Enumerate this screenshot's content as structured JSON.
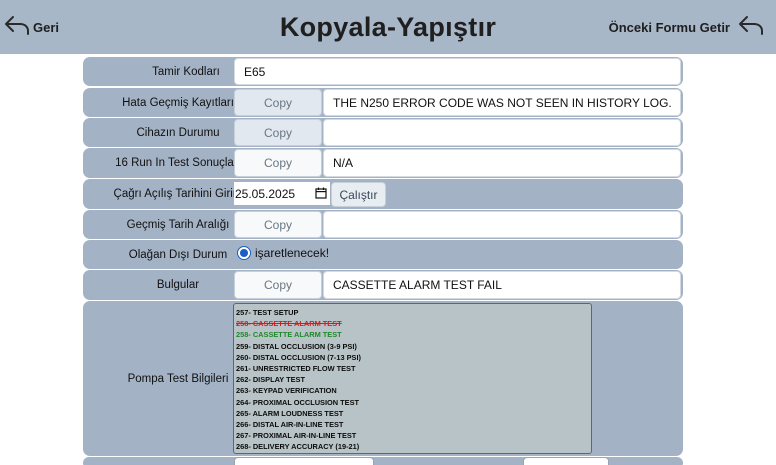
{
  "header": {
    "title": "Kopyala-Yapıştır",
    "back_label": "Geri",
    "previous_form_label": "Önceki Formu Getir"
  },
  "fields": {
    "repair_codes": {
      "label": "Tamir Kodları",
      "value": "E65"
    },
    "error_history": {
      "label": "Hata Geçmiş Kayıtları",
      "copy_label": "Copy",
      "value": "THE N250 ERROR CODE WAS NOT SEEN IN HISTORY LOG."
    },
    "device_status": {
      "label": "Cihazın Durumu",
      "copy_label": "Copy",
      "value": ""
    },
    "run_in_test": {
      "label": "16 Run In Test Sonuçları",
      "copy_label": "Copy",
      "value": "N/A"
    },
    "call_open_date": {
      "label": "Çağrı Açılış Tarihini Girin!",
      "value": "25.05.2025",
      "run_label": "Çalıştır"
    },
    "history_range": {
      "label": "Geçmiş Tarih Aralığı",
      "copy_label": "Copy",
      "value": ""
    },
    "abnormal_status": {
      "label": "Olağan Dışı Durum",
      "option_label": "işaretlenecek!",
      "selected": true
    },
    "findings": {
      "label": "Bulgular",
      "copy_label": "Copy",
      "value": "CASSETTE ALARM TEST FAIL"
    },
    "pump_test_info": {
      "label": "Pompa Test Bilgileri",
      "items": [
        {
          "text": "257- TEST SETUP",
          "status": "normal"
        },
        {
          "text": "258- CASSETTE ALARM TEST",
          "status": "failed"
        },
        {
          "text": "258- CASSETTE ALARM TEST",
          "status": "passed"
        },
        {
          "text": "259- DISTAL OCCLUSION (3-9 PSI)",
          "status": "normal"
        },
        {
          "text": "260- DISTAL OCCLUSION (7-13 PSI)",
          "status": "normal"
        },
        {
          "text": "261- UNRESTRICTED FLOW TEST",
          "status": "normal"
        },
        {
          "text": "262- DISPLAY TEST",
          "status": "normal"
        },
        {
          "text": "263- KEYPAD VERIFICATION",
          "status": "normal"
        },
        {
          "text": "264- PROXIMAL OCCLUSION TEST",
          "status": "normal"
        },
        {
          "text": "265- ALARM LOUDNESS TEST",
          "status": "normal"
        },
        {
          "text": "266- DISTAL AIR-IN-LINE TEST",
          "status": "normal"
        },
        {
          "text": "267- PROXIMAL AIR-IN-LINE TEST",
          "status": "normal"
        },
        {
          "text": "268- DELIVERY ACCURACY (19-21)",
          "status": "normal"
        }
      ]
    }
  },
  "icons": {
    "back": "undo-arrow-icon",
    "previous_form": "undo-arrow-icon",
    "calendar": "calendar-icon"
  },
  "colors": {
    "header_bg": "#a7b7c8",
    "row_bg": "#a3b2c4",
    "failed": "#d41c1c",
    "passed": "#1f8a2b",
    "radio": "#1a5ec4"
  }
}
